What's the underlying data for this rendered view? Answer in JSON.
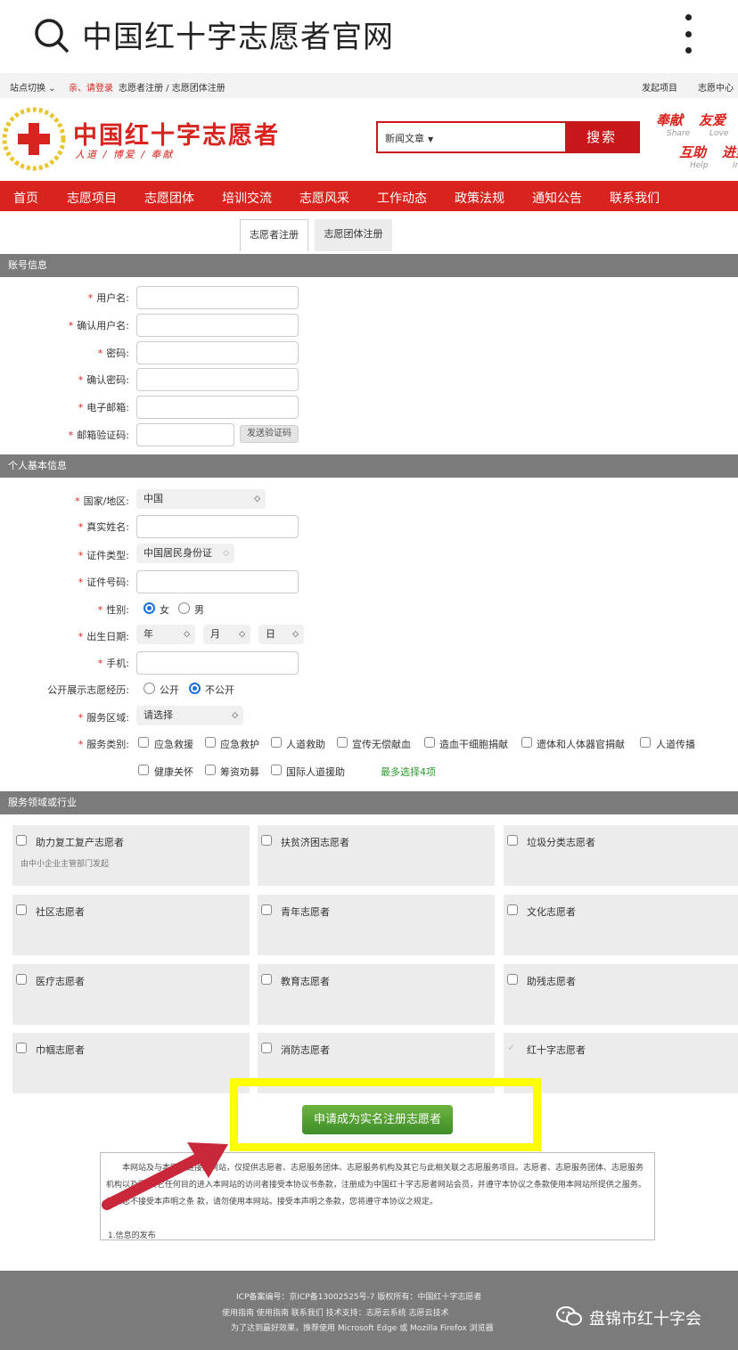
{
  "browser": {
    "title": "中国红十字志愿者官网"
  },
  "utilbar": {
    "site_switch": "站点切换 ⌄",
    "login": "亲、请登录",
    "register": "志愿者注册 / 志愿团体注册",
    "initiate": "发起项目",
    "center": "志愿中心"
  },
  "header": {
    "site_name": "中国红十字志愿者",
    "slogan": "人道 / 博爱 / 奉献",
    "search": {
      "category": "新闻文章",
      "button": "搜索"
    },
    "mottos": [
      {
        "cn": "奉献",
        "en": "Share"
      },
      {
        "cn": "友爱",
        "en": "Love"
      },
      {
        "cn": "互助",
        "en": "Help"
      },
      {
        "cn": "进步",
        "en": "Impr"
      }
    ]
  },
  "nav": [
    "首页",
    "志愿项目",
    "志愿团体",
    "培训交流",
    "志愿风采",
    "工作动态",
    "政策法规",
    "通知公告",
    "联系我们"
  ],
  "tabs": {
    "volunteer": "志愿者注册",
    "group": "志愿团体注册"
  },
  "account": {
    "title": "账号信息",
    "username": "用户名:",
    "confirm_username": "确认用户名:",
    "password": "密码:",
    "confirm_password": "确认密码:",
    "email": "电子邮箱:",
    "email_code": "邮箱验证码:",
    "send_code": "发送验证码"
  },
  "personal": {
    "title": "个人基本信息",
    "country_label": "国家/地区:",
    "country_value": "中国",
    "name_label": "真实姓名:",
    "id_type_label": "证件类型:",
    "id_type_value": "中国居民身份证",
    "id_no_label": "证件号码:",
    "gender_label": "性别:",
    "female": "女",
    "male": "男",
    "birth_label": "出生日期:",
    "year": "年",
    "month": "月",
    "day": "日",
    "phone_label": "手机:",
    "public_label": "公开展示志愿经历:",
    "public_yes": "公开",
    "public_no": "不公开",
    "area_label": "服务区域:",
    "area_value": "请选择",
    "type_label": "服务类别:",
    "types": [
      "应急救援",
      "应急救护",
      "人道救助",
      "宣传无偿献血",
      "造血干细胞捐献",
      "遗体和人体器官捐献",
      "人道传播",
      "健康关怀",
      "筹资劝募",
      "国际人道援助"
    ],
    "max_note": "最多选择4项"
  },
  "fields": {
    "title": "服务领域或行业",
    "items": [
      {
        "label": "助力复工复产志愿者",
        "sub": "由中小企业主管部门发起"
      },
      {
        "label": "扶贫济困志愿者"
      },
      {
        "label": "垃圾分类志愿者"
      },
      {
        "label": "社区志愿者"
      },
      {
        "label": "青年志愿者"
      },
      {
        "label": "文化志愿者"
      },
      {
        "label": "医疗志愿者"
      },
      {
        "label": "教育志愿者"
      },
      {
        "label": "助残志愿者"
      },
      {
        "label": "巾帼志愿者"
      },
      {
        "label": "消防志愿者"
      },
      {
        "label": "红十字志愿者"
      }
    ]
  },
  "apply_button": "申请成为实名注册志愿者",
  "agreement": {
    "text": "本网站及与本网站链接的网站，仅提供志愿者、志愿服务团体、志愿服务机构及其它与此相关联之志愿服务项目。志愿者、志愿服务团体、志愿服务机构以及因 其它任何目的进入本网站的访问者接受本协议书条款，注册成为中国红十字志愿者网站会员，并遵守本协议之条款使用本网站所提供之服务。如果您不接受本声明之条 款，请勿使用本网站。接受本声明之条款，您将遵守本协议之规定。",
    "point1": "1.信息的发布"
  },
  "footer": {
    "line1": "ICP备案编号：京ICP备13002525号-7    版权所有：中国红十字志愿者",
    "line2": "使用指南    使用指南    联系我们    技术支持：志愿云系统    志愿云技术",
    "line3": "为了达到最好效果，推荐使用 Microsoft Edge  或 Mozilla Firefox  浏览器",
    "watermark": "盘锦市红十字会"
  },
  "colors": {
    "brand_red": "#d8231e",
    "section_gray": "#7b7b7b",
    "apply_green": "#3e8e2a",
    "highlight": "#ffff00",
    "arrow": "#c8283a"
  }
}
